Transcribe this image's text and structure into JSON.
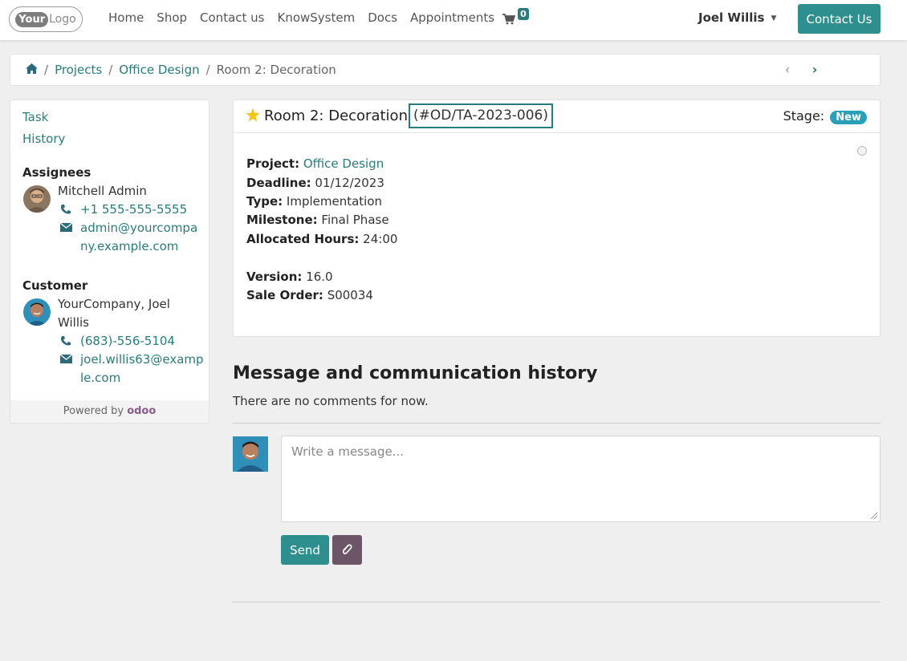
{
  "navbar": {
    "logo_bold": "Your",
    "logo_rest": "Logo",
    "links": [
      "Home",
      "Shop",
      "Contact us",
      "KnowSystem",
      "Docs",
      "Appointments"
    ],
    "cart_count": "0",
    "user_name": "Joel Willis",
    "contact_button": "Contact Us"
  },
  "breadcrumb": {
    "items": [
      "Projects",
      "Office Design"
    ],
    "current": "Room 2: Decoration",
    "separator": "/",
    "prev_glyph": "‹",
    "next_glyph": "›"
  },
  "sidebar": {
    "links": [
      "Task",
      "History"
    ],
    "assignees_heading": "Assignees",
    "assignee": {
      "name": "Mitchell Admin",
      "phone": "+1 555-555-5555",
      "email": "admin@yourcompany.example.com"
    },
    "customer_heading": "Customer",
    "customer": {
      "name": "YourCompany, Joel Willis",
      "phone": "(683)-556-5104",
      "email": "joel.willis63@example.com"
    },
    "powered_by": "Powered by",
    "powered_brand": "odoo"
  },
  "task": {
    "title": "Room 2: Decoration",
    "reference": "(#OD/TA-2023-006)",
    "stage_label": "Stage:",
    "stage_value": "New",
    "fields": {
      "project_label": "Project:",
      "project_value": "Office Design",
      "deadline_label": "Deadline:",
      "deadline_value": "01/12/2023",
      "type_label": "Type:",
      "type_value": "Implementation",
      "milestone_label": "Milestone:",
      "milestone_value": "Final Phase",
      "hours_label": "Allocated Hours:",
      "hours_value": "24:00",
      "version_label": "Version:",
      "version_value": "16.0",
      "sale_order_label": "Sale Order:",
      "sale_order_value": "S00034"
    }
  },
  "messages": {
    "title": "Message and communication history",
    "empty_text": "There are no comments for now.",
    "placeholder": "Write a message...",
    "send_label": "Send"
  },
  "colors": {
    "accent": "#2f8f8f",
    "link": "#2a7b7b",
    "stage_badge": "#2aa0b8",
    "attach_button": "#6b5566"
  }
}
